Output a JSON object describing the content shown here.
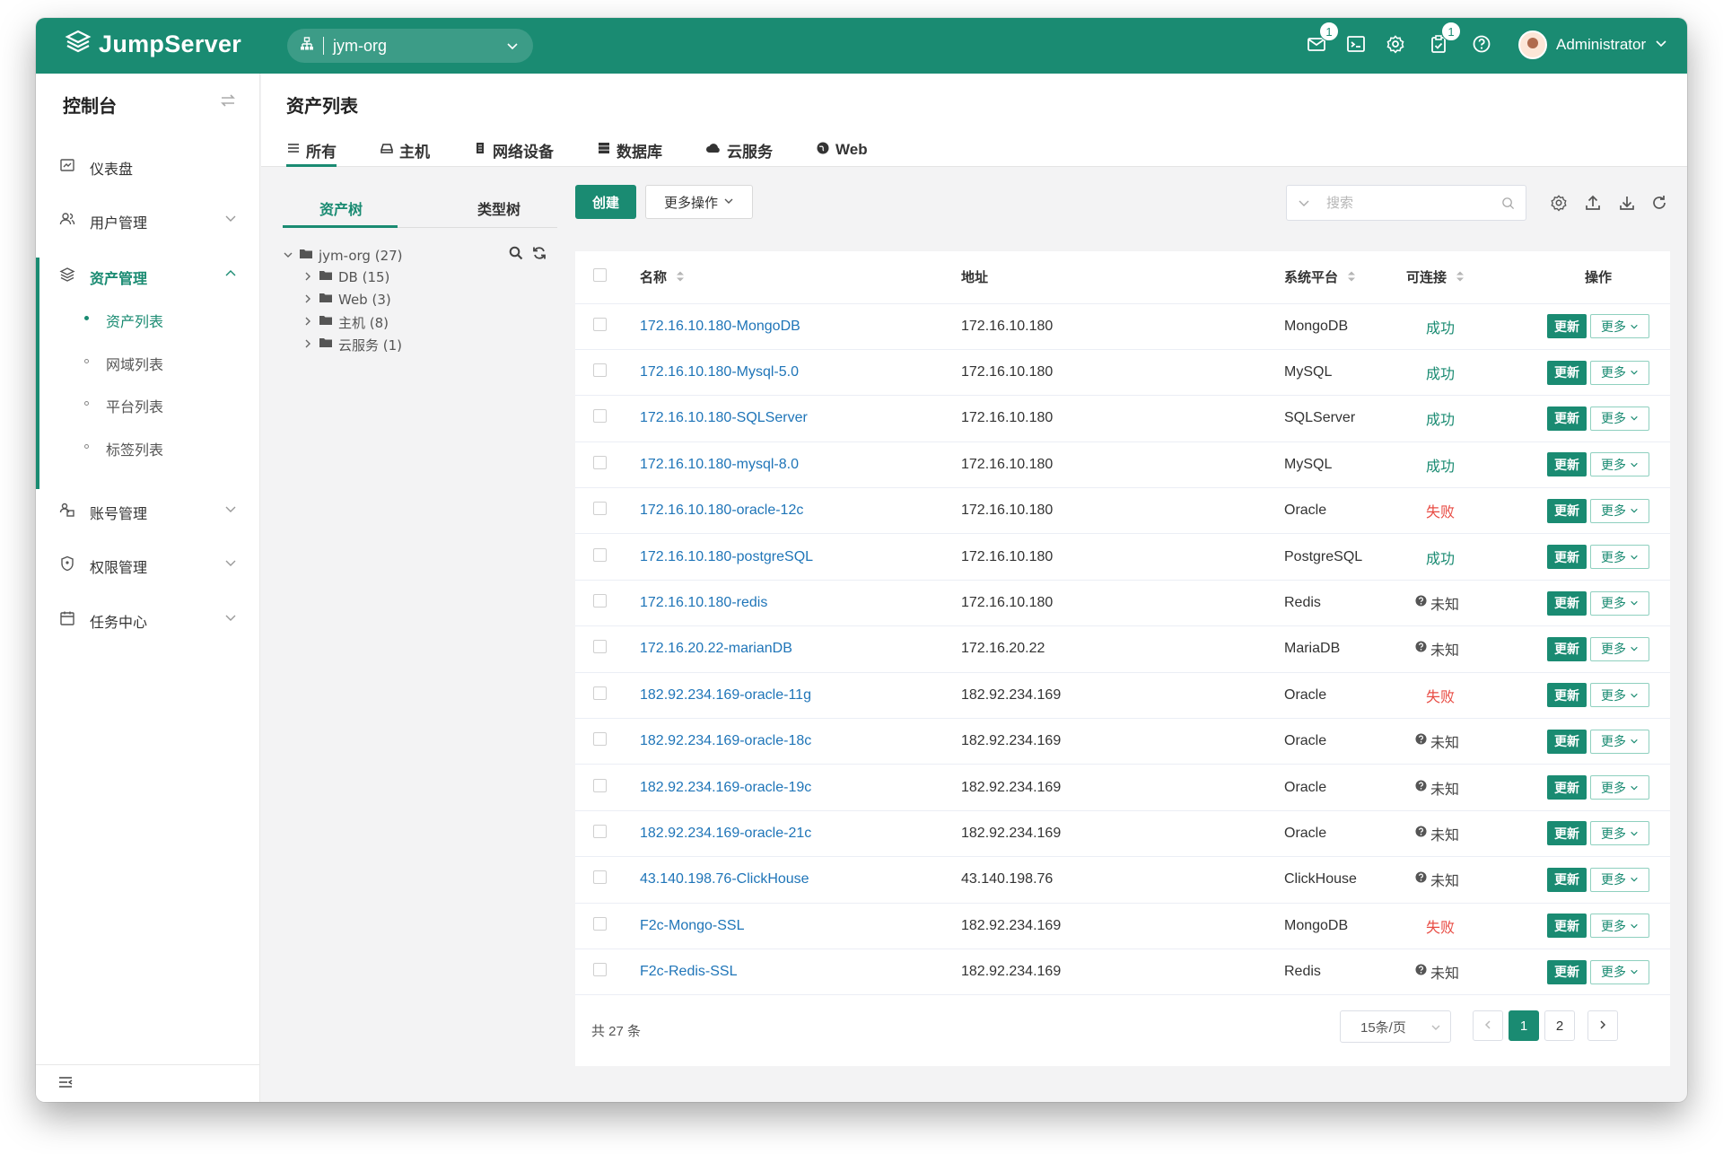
{
  "header": {
    "brand": "JumpServer",
    "org": "jym-org",
    "badges": {
      "messages": "1",
      "tickets": "1"
    },
    "user": "Administrator"
  },
  "sidebar": {
    "title": "控制台",
    "items": [
      {
        "label": "仪表盘",
        "icon": "dashboard-icon"
      },
      {
        "label": "用户管理",
        "icon": "users-icon"
      },
      {
        "label": "资产管理",
        "icon": "assets-icon"
      },
      {
        "label": "账号管理",
        "icon": "accounts-icon"
      },
      {
        "label": "权限管理",
        "icon": "permissions-icon"
      },
      {
        "label": "任务中心",
        "icon": "tasks-icon"
      }
    ],
    "sub_items": [
      "资产列表",
      "网域列表",
      "平台列表",
      "标签列表"
    ]
  },
  "page": {
    "title": "资产列表",
    "tabs": [
      "所有",
      "主机",
      "网络设备",
      "数据库",
      "云服务",
      "Web"
    ]
  },
  "tree": {
    "tabs": [
      "资产树",
      "类型树"
    ],
    "root": "jym-org (27)",
    "children": [
      "DB (15)",
      "Web (3)",
      "主机 (8)",
      "云服务 (1)"
    ]
  },
  "toolbar": {
    "create": "创建",
    "more_ops": "更多操作",
    "search_placeholder": "搜索"
  },
  "table": {
    "headers": {
      "name": "名称",
      "address": "地址",
      "platform": "系统平台",
      "connectivity": "可连接",
      "actions": "操作"
    },
    "update_label": "更新",
    "more_label": "更多",
    "rows": [
      {
        "name": "172.16.10.180-MongoDB",
        "address": "172.16.10.180",
        "platform": "MongoDB",
        "status": "成功",
        "state": "ok"
      },
      {
        "name": "172.16.10.180-Mysql-5.0",
        "address": "172.16.10.180",
        "platform": "MySQL",
        "status": "成功",
        "state": "ok"
      },
      {
        "name": "172.16.10.180-SQLServer",
        "address": "172.16.10.180",
        "platform": "SQLServer",
        "status": "成功",
        "state": "ok"
      },
      {
        "name": "172.16.10.180-mysql-8.0",
        "address": "172.16.10.180",
        "platform": "MySQL",
        "status": "成功",
        "state": "ok"
      },
      {
        "name": "172.16.10.180-oracle-12c",
        "address": "172.16.10.180",
        "platform": "Oracle",
        "status": "失败",
        "state": "fail"
      },
      {
        "name": "172.16.10.180-postgreSQL",
        "address": "172.16.10.180",
        "platform": "PostgreSQL",
        "status": "成功",
        "state": "ok"
      },
      {
        "name": "172.16.10.180-redis",
        "address": "172.16.10.180",
        "platform": "Redis",
        "status": "未知",
        "state": "unknown"
      },
      {
        "name": "172.16.20.22-marianDB",
        "address": "172.16.20.22",
        "platform": "MariaDB",
        "status": "未知",
        "state": "unknown"
      },
      {
        "name": "182.92.234.169-oracle-11g",
        "address": "182.92.234.169",
        "platform": "Oracle",
        "status": "失败",
        "state": "fail"
      },
      {
        "name": "182.92.234.169-oracle-18c",
        "address": "182.92.234.169",
        "platform": "Oracle",
        "status": "未知",
        "state": "unknown"
      },
      {
        "name": "182.92.234.169-oracle-19c",
        "address": "182.92.234.169",
        "platform": "Oracle",
        "status": "未知",
        "state": "unknown"
      },
      {
        "name": "182.92.234.169-oracle-21c",
        "address": "182.92.234.169",
        "platform": "Oracle",
        "status": "未知",
        "state": "unknown"
      },
      {
        "name": "43.140.198.76-ClickHouse",
        "address": "43.140.198.76",
        "platform": "ClickHouse",
        "status": "未知",
        "state": "unknown"
      },
      {
        "name": "F2c-Mongo-SSL",
        "address": "182.92.234.169",
        "platform": "MongoDB",
        "status": "失败",
        "state": "fail"
      },
      {
        "name": "F2c-Redis-SSL",
        "address": "182.92.234.169",
        "platform": "Redis",
        "status": "未知",
        "state": "unknown"
      }
    ]
  },
  "pagination": {
    "total": "共 27 条",
    "page_size": "15条/页",
    "pages": [
      "1",
      "2"
    ],
    "current": "1"
  },
  "colors": {
    "brand": "#1a8b72",
    "link": "#1f75b8",
    "fail": "#e84b43"
  }
}
